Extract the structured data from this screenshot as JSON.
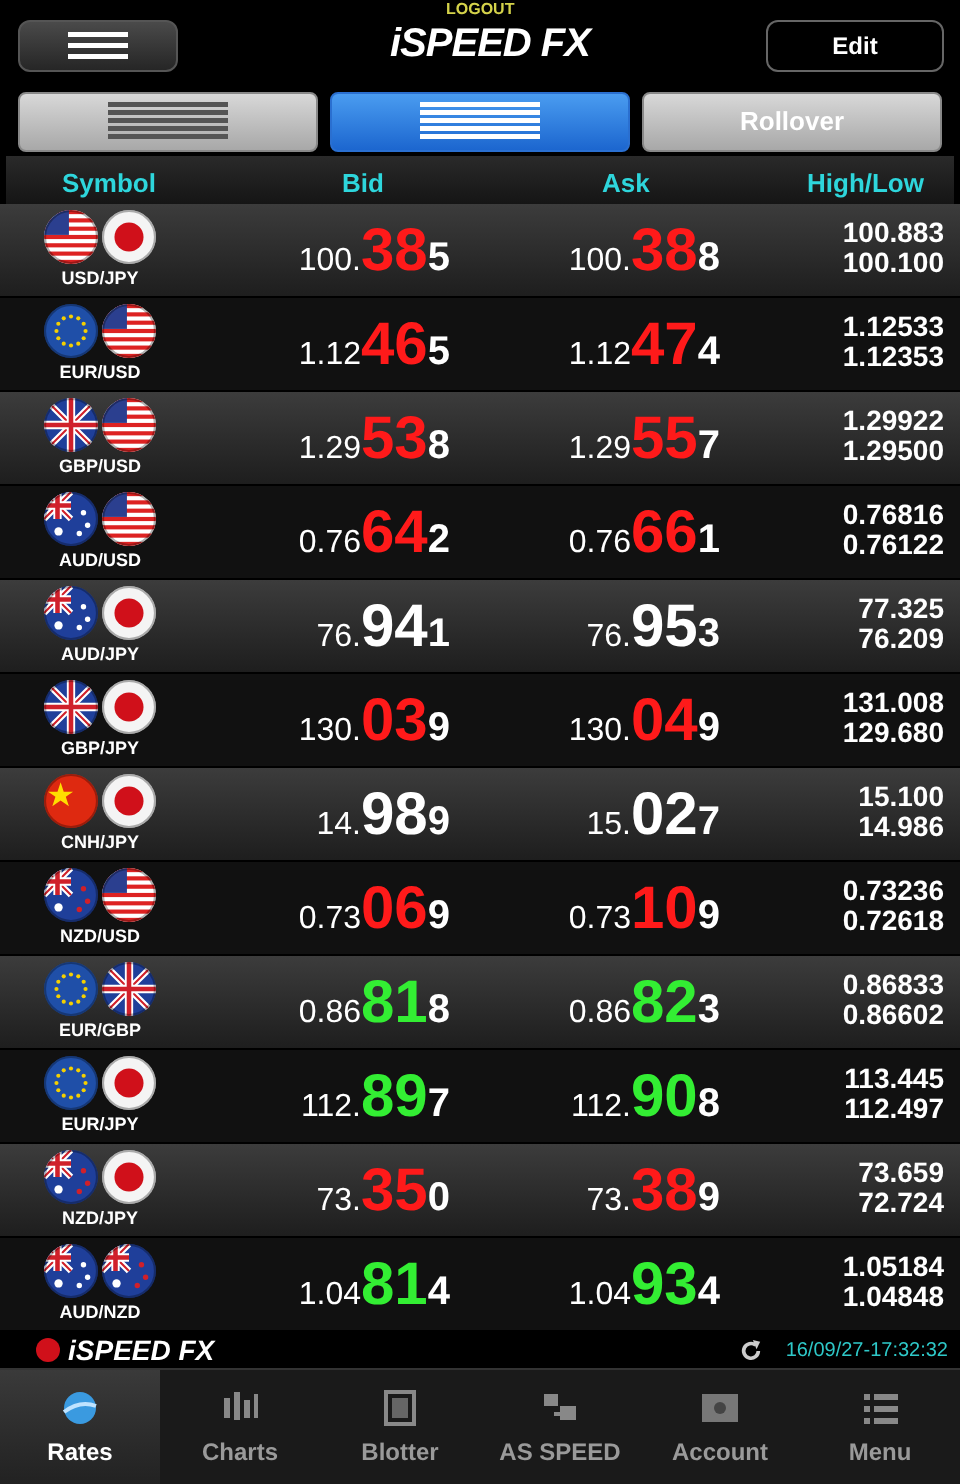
{
  "header": {
    "logout": "LOGOUT",
    "logo": "iSPEED FX",
    "edit": "Edit"
  },
  "segments": [
    {
      "kind": "icon",
      "selected": false
    },
    {
      "kind": "icon",
      "selected": true
    },
    {
      "kind": "text",
      "label": "Rollover",
      "selected": false
    }
  ],
  "columns": [
    "Symbol",
    "Bid",
    "Ask",
    "High/Low"
  ],
  "rows": [
    {
      "symbol": "USD/JPY",
      "color": "#ff1a1a",
      "bid": [
        "100.",
        "38",
        "5"
      ],
      "ask": [
        "100.",
        "38",
        "8"
      ],
      "high": "100.883",
      "low": "100.100"
    },
    {
      "symbol": "EUR/USD",
      "color": "#ff1a1a",
      "bid": [
        "1.12",
        "46",
        "5"
      ],
      "ask": [
        "1.12",
        "47",
        "4"
      ],
      "high": "1.12533",
      "low": "1.12353"
    },
    {
      "symbol": "GBP/USD",
      "color": "#ff1a1a",
      "bid": [
        "1.29",
        "53",
        "8"
      ],
      "ask": [
        "1.29",
        "55",
        "7"
      ],
      "high": "1.29922",
      "low": "1.29500"
    },
    {
      "symbol": "AUD/USD",
      "color": "#ff1a1a",
      "bid": [
        "0.76",
        "64",
        "2"
      ],
      "ask": [
        "0.76",
        "66",
        "1"
      ],
      "high": "0.76816",
      "low": "0.76122"
    },
    {
      "symbol": "AUD/JPY",
      "color": "#ffffff",
      "bid": [
        "76.",
        "94",
        "1"
      ],
      "ask": [
        "76.",
        "95",
        "3"
      ],
      "high": "77.325",
      "low": "76.209"
    },
    {
      "symbol": "GBP/JPY",
      "color": "#ff1a1a",
      "bid": [
        "130.",
        "03",
        "9"
      ],
      "ask": [
        "130.",
        "04",
        "9"
      ],
      "high": "131.008",
      "low": "129.680"
    },
    {
      "symbol": "CNH/JPY",
      "color": "#ffffff",
      "bid": [
        "14.",
        "98",
        "9"
      ],
      "ask": [
        "15.",
        "02",
        "7"
      ],
      "high": "15.100",
      "low": "14.986"
    },
    {
      "symbol": "NZD/USD",
      "color": "#ff1a1a",
      "bid": [
        "0.73",
        "06",
        "9"
      ],
      "ask": [
        "0.73",
        "10",
        "9"
      ],
      "high": "0.73236",
      "low": "0.72618"
    },
    {
      "symbol": "EUR/GBP",
      "color": "#33ee33",
      "bid": [
        "0.86",
        "81",
        "8"
      ],
      "ask": [
        "0.86",
        "82",
        "3"
      ],
      "high": "0.86833",
      "low": "0.86602"
    },
    {
      "symbol": "EUR/JPY",
      "color": "#33ee33",
      "bid": [
        "112.",
        "89",
        "7"
      ],
      "ask": [
        "112.",
        "90",
        "8"
      ],
      "high": "113.445",
      "low": "112.497"
    },
    {
      "symbol": "NZD/JPY",
      "color": "#ff1a1a",
      "bid": [
        "73.",
        "35",
        "0"
      ],
      "ask": [
        "73.",
        "38",
        "9"
      ],
      "high": "73.659",
      "low": "72.724"
    },
    {
      "symbol": "AUD/NZD",
      "color": "#33ee33",
      "bid": [
        "1.04",
        "81",
        "4"
      ],
      "ask": [
        "1.04",
        "93",
        "4"
      ],
      "high": "1.05184",
      "low": "1.04848"
    }
  ],
  "status_bar": {
    "logo": "iSPEED FX",
    "timestamp": "16/09/27-17:32:32"
  },
  "tabs": [
    {
      "label": "Rates",
      "selected": true
    },
    {
      "label": "Charts",
      "selected": false
    },
    {
      "label": "Blotter",
      "selected": false
    },
    {
      "label": "AS SPEED",
      "selected": false
    },
    {
      "label": "Account",
      "selected": false
    },
    {
      "label": "Menu",
      "selected": false
    }
  ]
}
